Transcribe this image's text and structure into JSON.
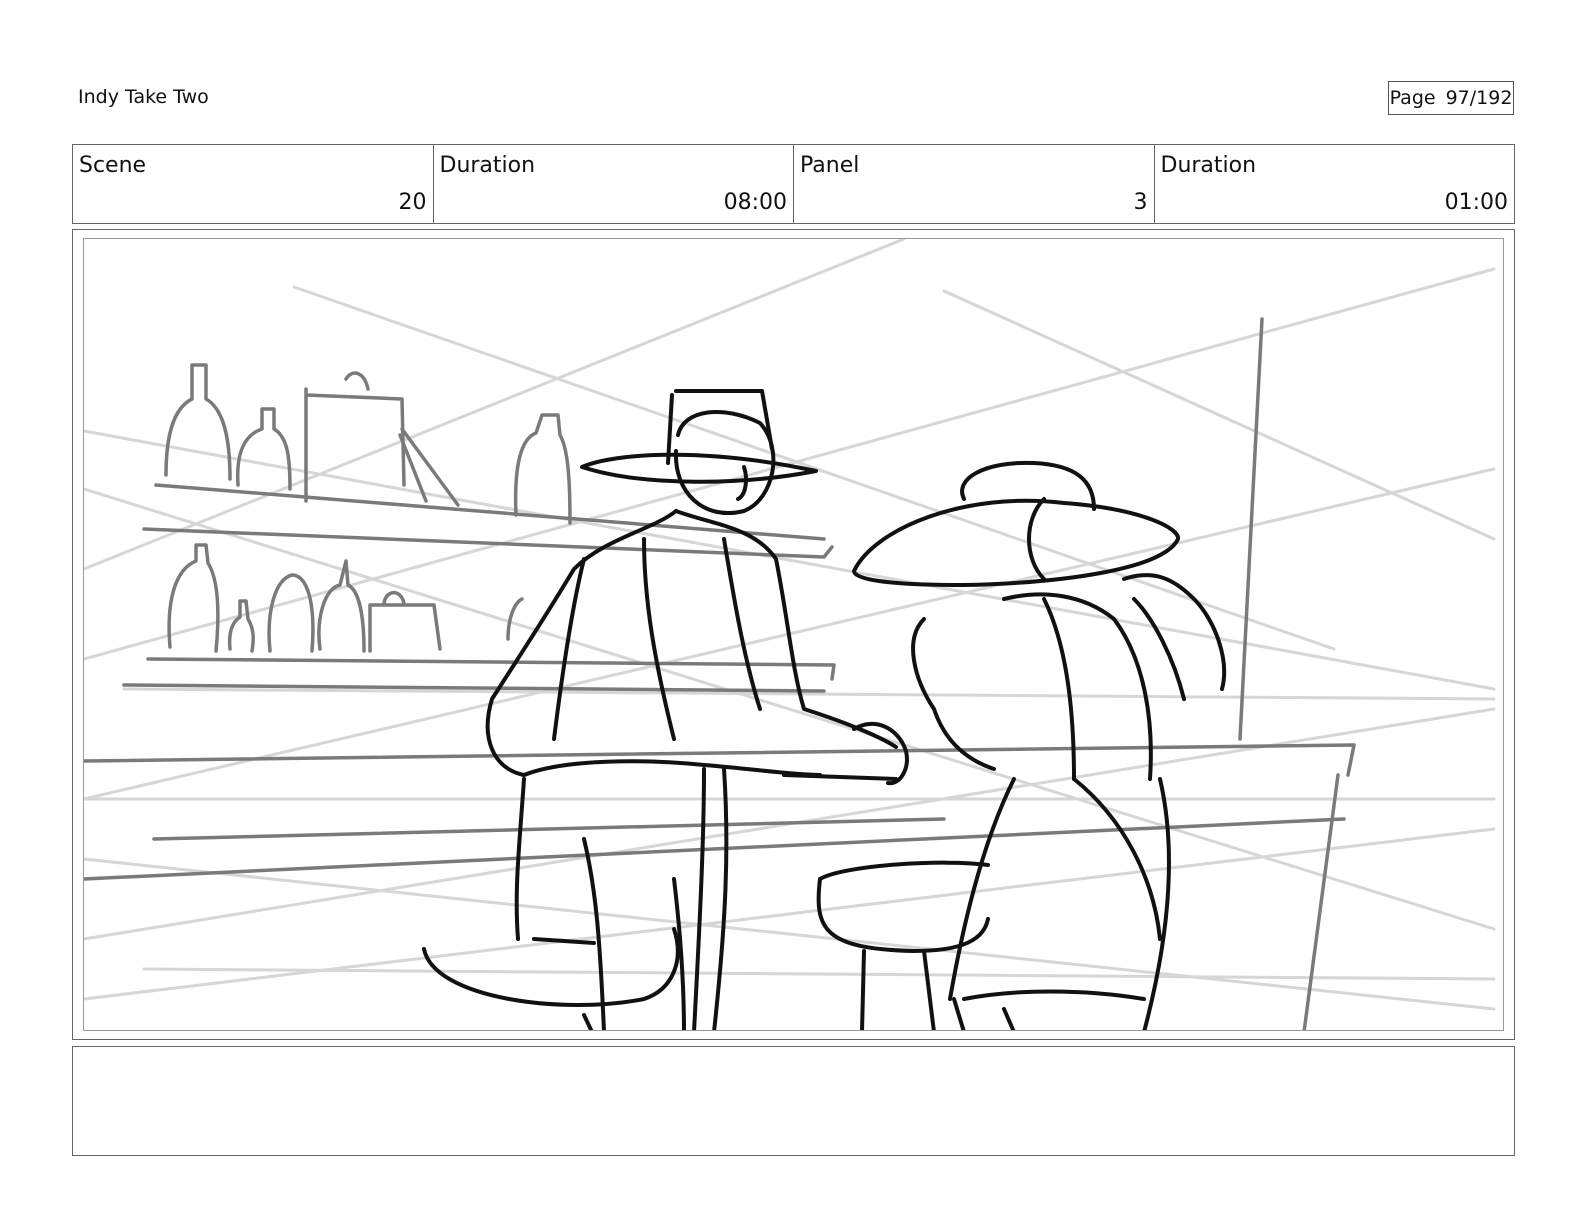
{
  "header": {
    "project_title": "Indy Take Two",
    "page_label": "Page",
    "page_number": "97/192"
  },
  "info": {
    "scene_label": "Scene",
    "scene_value": "20",
    "scene_duration_label": "Duration",
    "scene_duration_value": "08:00",
    "panel_label": "Panel",
    "panel_value": "3",
    "panel_duration_label": "Duration",
    "panel_duration_value": "01:00"
  },
  "notes": {
    "text": ""
  },
  "colors": {
    "ink": "#111111",
    "shelf_ink": "#7a7a7a",
    "guide_lines": "#d4d4d4",
    "border": "#666666"
  }
}
